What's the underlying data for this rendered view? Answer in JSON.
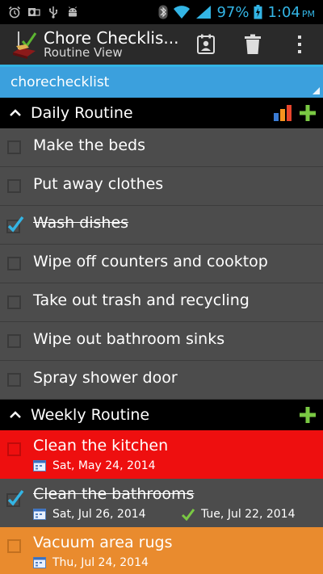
{
  "status_bar": {
    "battery": "97%",
    "time": "1:04",
    "ampm": "PM",
    "left_icons": [
      "alarm-icon",
      "outlook-icon",
      "usb-icon",
      "android-icon"
    ],
    "right_icons": [
      "bluetooth-icon",
      "wifi-icon",
      "signal-icon",
      "battery-icon"
    ]
  },
  "action_bar": {
    "title": "Chore Checklis...",
    "subtitle": "Routine View",
    "actions": [
      "calendar-contact-icon",
      "trash-icon",
      "overflow-menu-icon"
    ]
  },
  "spinner": {
    "value": "chorechecklist"
  },
  "daily": {
    "label": "Daily Routine",
    "items": [
      {
        "label": "Make the beds",
        "checked": false
      },
      {
        "label": "Put away clothes",
        "checked": false
      },
      {
        "label": "Wash dishes",
        "checked": true
      },
      {
        "label": "Wipe off counters and cooktop",
        "checked": false
      },
      {
        "label": "Take out trash and recycling",
        "checked": false
      },
      {
        "label": "Wipe out bathroom sinks",
        "checked": false
      },
      {
        "label": "Spray shower door",
        "checked": false
      }
    ]
  },
  "weekly": {
    "label": "Weekly Routine",
    "items": [
      {
        "label": "Clean the kitchen",
        "date": "Sat, May 24, 2014",
        "checked": false,
        "color": "#ee0f0f"
      },
      {
        "label": "Clean the bathrooms",
        "date": "Sat, Jul 26, 2014",
        "done_date": "Tue, Jul 22, 2014",
        "checked": true,
        "color": "#4c4c4c"
      },
      {
        "label": "Vacuum area rugs",
        "date": "Thu, Jul 24, 2014",
        "checked": false,
        "color": "#e98b2e"
      }
    ]
  },
  "colors": {
    "accent_blue": "#33b5e5",
    "add_green": "#7ac943",
    "row_gray": "#4c4c4c"
  }
}
